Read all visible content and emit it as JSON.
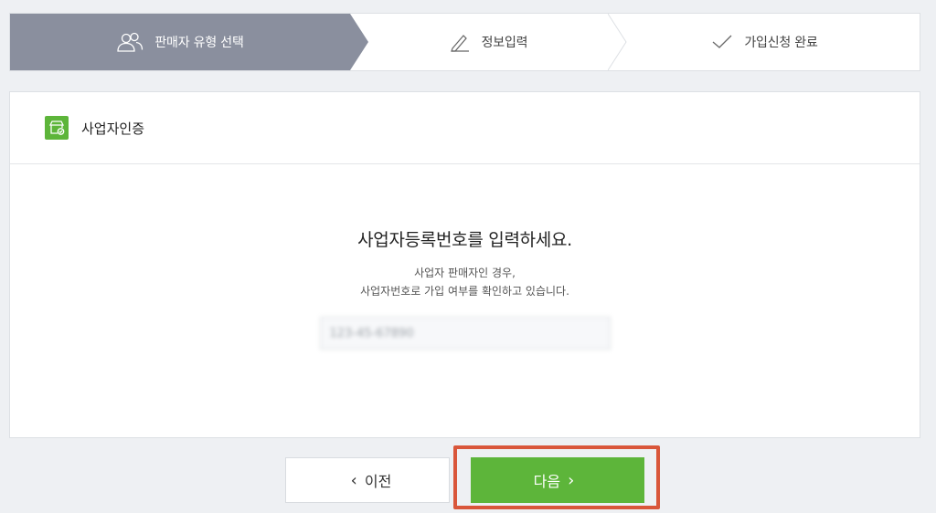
{
  "colors": {
    "active_step_bg": "#8a8f9e",
    "accent_green": "#5db53a",
    "highlight_red": "#d9563a"
  },
  "stepper": {
    "steps": [
      {
        "label": "판매자 유형 선택",
        "icon": "users-icon",
        "active": true
      },
      {
        "label": "정보입력",
        "icon": "pencil-icon",
        "active": false
      },
      {
        "label": "가입신청 완료",
        "icon": "check-icon",
        "active": false
      }
    ]
  },
  "card": {
    "title": "사업자인증",
    "icon": "store-check-icon",
    "headline": "사업자등록번호를 입력하세요.",
    "desc_line1": "사업자 판매자인 경우,",
    "desc_line2": "사업자번호로 가입 여부를 확인하고 있습니다.",
    "input_value": "123-45-67890"
  },
  "buttons": {
    "prev_label": "이전",
    "next_label": "다음"
  }
}
